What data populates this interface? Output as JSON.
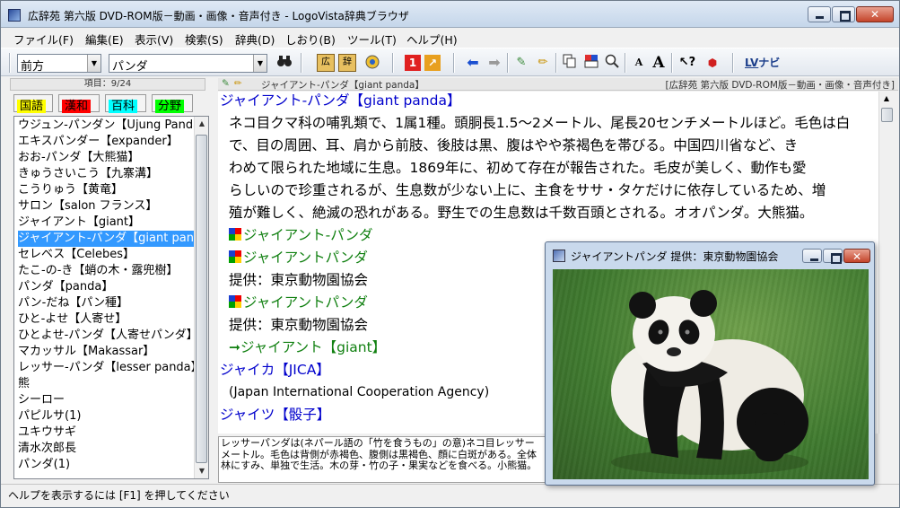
{
  "window": {
    "title": "広辞苑 第六版 DVD-ROM版－動画・画像・音声付き - LogoVista辞典ブラウザ"
  },
  "menu": [
    "ファイル(F)",
    "編集(E)",
    "表示(V)",
    "検索(S)",
    "辞典(D)",
    "しおり(B)",
    "ツール(T)",
    "ヘルプ(H)"
  ],
  "toolbar": {
    "search_mode": "前方",
    "search_text": "パンダ",
    "lv_navi_label": "ナビ"
  },
  "left": {
    "count": "項目：9/24",
    "tabs": [
      "国語",
      "漢和",
      "百科",
      "分野"
    ],
    "tab_colors": [
      "#ffff00",
      "#ff0000",
      "#00ffff",
      "#00ff00"
    ],
    "items": [
      "ウジュン-パンダン【Ujung Pandang】",
      "エキスパンダー【expander】",
      "おお-パンダ【大熊猫】",
      "きゅうさいこう【九寨溝】",
      "こうりゅう【黄竜】",
      "サロン【salon フランス】",
      "ジャイアント【giant】",
      "ジャイアント-パンダ【giant panda】",
      "セレベス【Celebes】",
      "たこ-の-き【蛸の木・露兜樹】",
      "パンダ【panda】",
      "パン-だね【パン種】",
      "ひと-よせ【人寄せ】",
      "ひとよせ-パンダ【人寄せパンダ】",
      "マカッサル【Makassar】",
      "レッサー-パンダ【lesser panda】",
      "熊",
      "シーロー",
      "パピルサ(1)",
      "ユキウサギ",
      "清水次郎長",
      "パンダ(1)"
    ],
    "selected_index": 7
  },
  "main": {
    "header_left": "ジャイアント-パンダ【giant panda】",
    "header_right": "[広辞苑 第六版 DVD-ROM版－動画・画像・音声付き]",
    "entry_title": "ジャイアント-パンダ【giant panda】",
    "body_lines": [
      "ネコ目クマ科の哺乳類で、1属1種。頭胴長1.5～2メートル、尾長20センチメートルほど。毛色は白",
      "で、目の周囲、耳、肩から前肢、後肢は黒、腹はやや茶褐色を帯びる。中国四川省など、き",
      "わめて限られた地域に生息。1869年に、初めて存在が報告された。毛皮が美しく、動作も愛",
      "らしいので珍重されるが、生息数が少ない上に、主食をササ・タケだけに依存しているため、増",
      "殖が難しく、絶滅の恐れがある。野生での生息数は千数百頭とされる。オオパンダ。大熊猫。"
    ],
    "media_links": [
      "ジャイアント-パンダ",
      "ジャイアントパンダ"
    ],
    "credit": "提供：東京動物園協会",
    "media_link_2": "ジャイアントパンダ",
    "credit_2": "提供：東京動物園協会",
    "xref": "ジャイアント【giant】",
    "entry2_title": "ジャイカ【JICA】",
    "entry2_body": "(Japan International Cooperation Agency)",
    "entry3_title": "ジャイツ【骰子】",
    "preview_lines": [
      "レッサーパンダは(ネパール語の「竹を食うもの」の意)ネコ目レッサー",
      "メートル。毛色は背側が赤褐色、腹側は黒褐色、顔に白斑がある。全体",
      "林にすみ、単独で生活。木の芽・竹の子・果実などを食べる。小熊猫。"
    ]
  },
  "popup": {
    "title": "ジャイアントパンダ 提供：東京動物園協会"
  },
  "status": "ヘルプを表示するには [F1] を押してください"
}
